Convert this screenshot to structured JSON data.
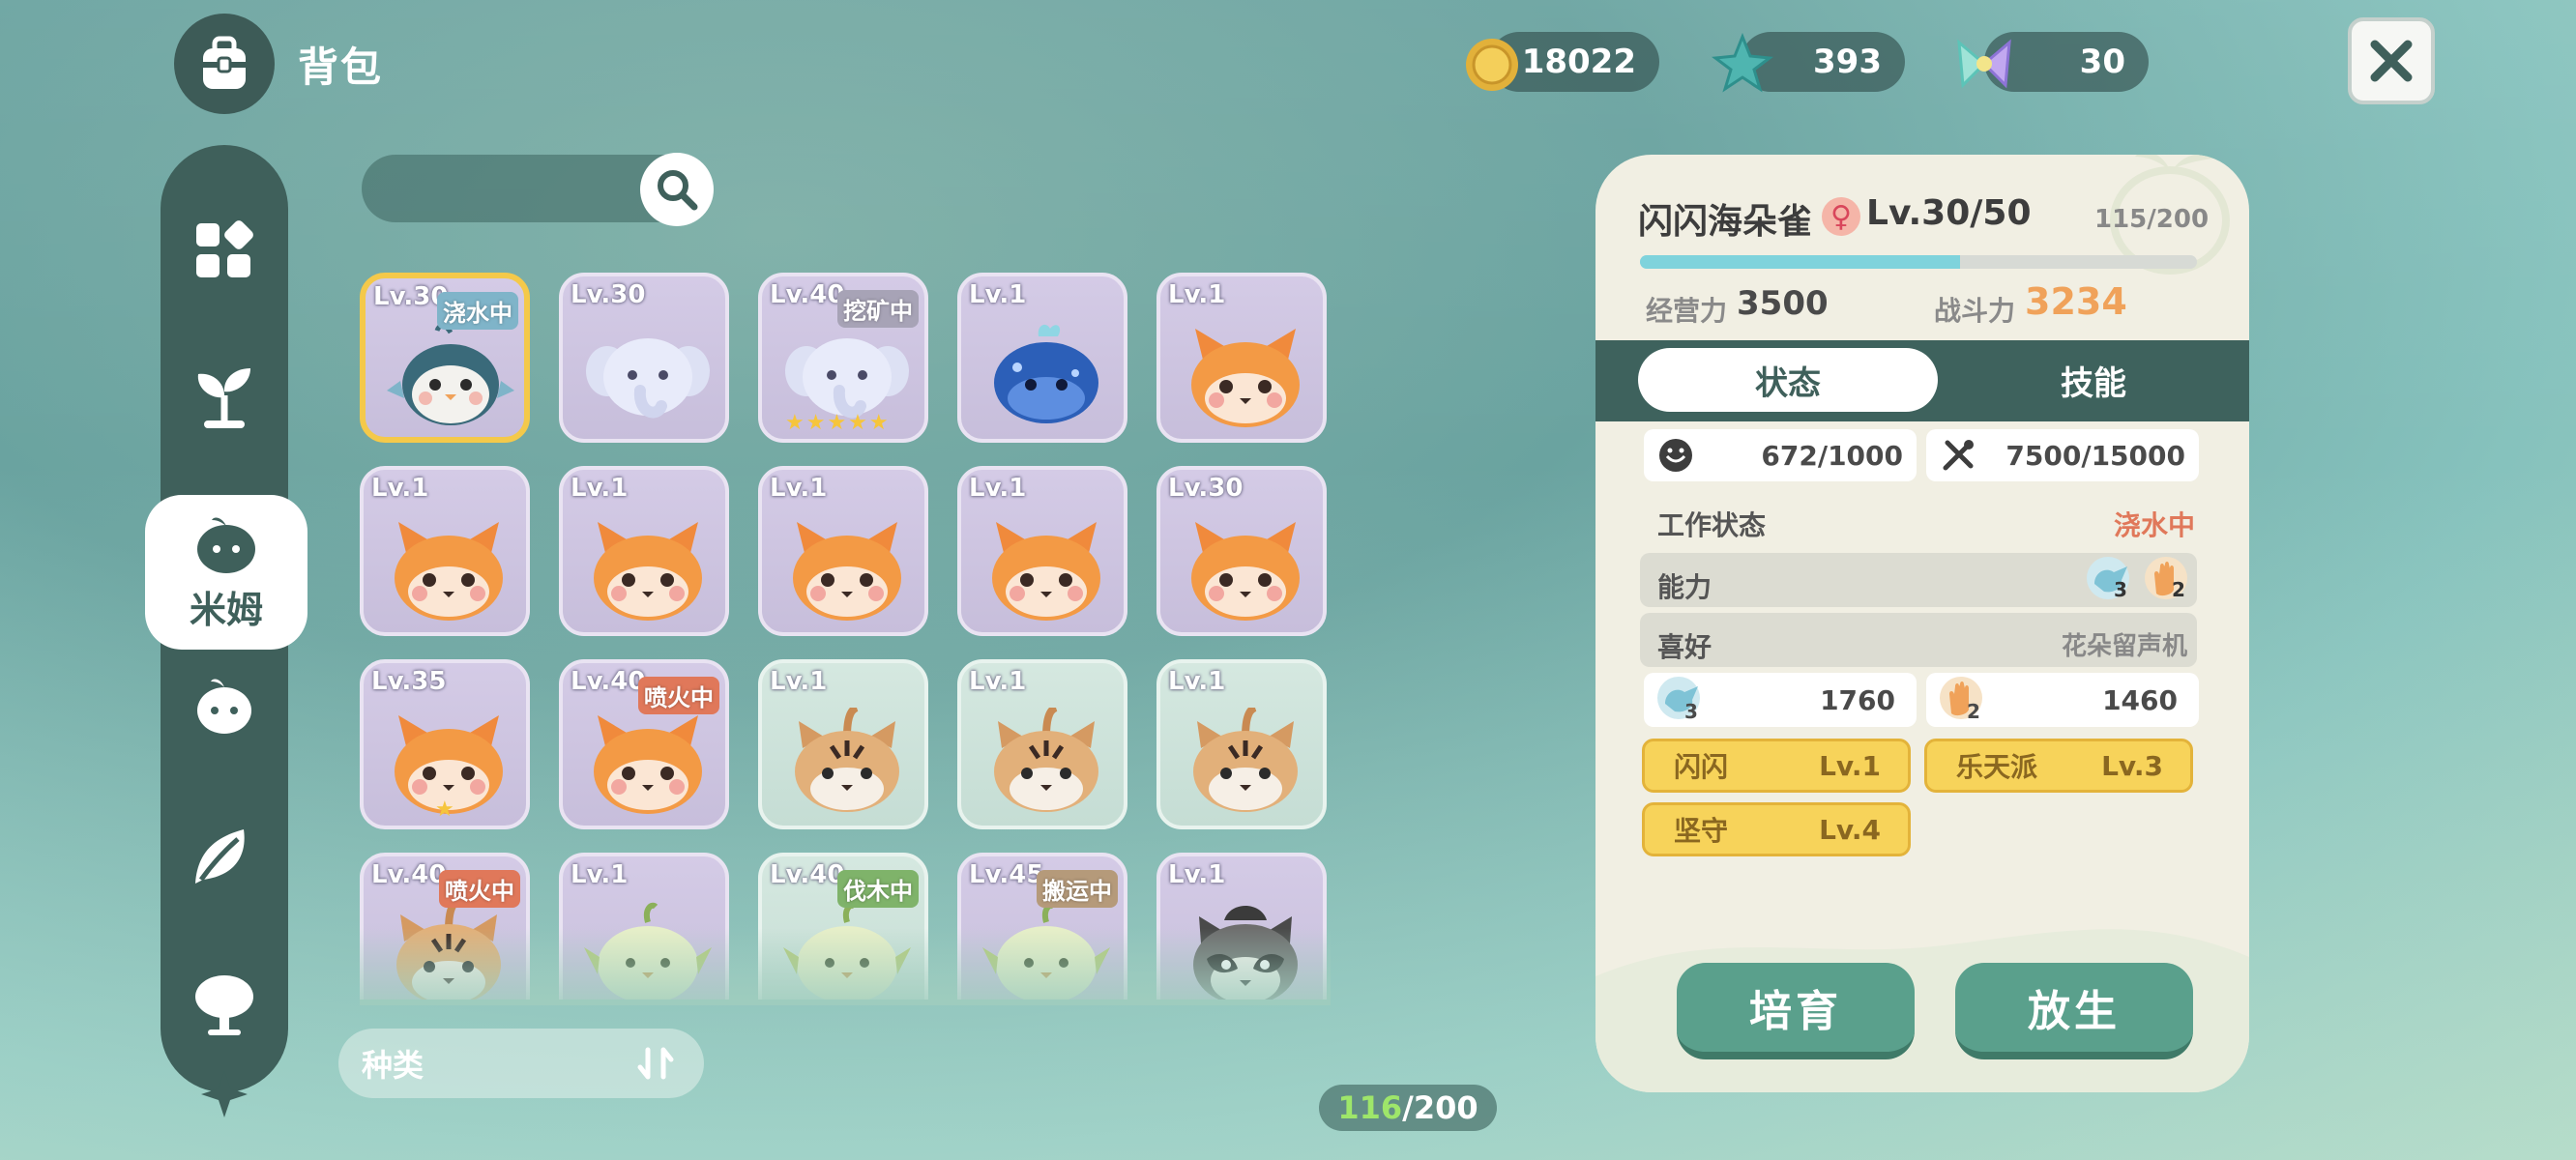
{
  "header": {
    "title": "背包"
  },
  "currencies": [
    {
      "icon": "gold-coin-icon",
      "value": "18022"
    },
    {
      "icon": "blue-star-icon",
      "value": "393"
    },
    {
      "icon": "crystal-bow-icon",
      "value": "30"
    }
  ],
  "sidebar": {
    "active_label": "米姆"
  },
  "grid": {
    "cards": [
      {
        "level": "Lv.30",
        "status": "浇水中",
        "status_color": "#7fb4c9",
        "bg": "purple",
        "creature": "bird",
        "selected": true,
        "stars": ""
      },
      {
        "level": "Lv.30",
        "status": "",
        "status_color": "",
        "bg": "purple",
        "creature": "elephant",
        "selected": false,
        "stars": ""
      },
      {
        "level": "Lv.40",
        "status": "挖矿中",
        "status_color": "#a7a3b6",
        "bg": "purple",
        "creature": "elephant",
        "selected": false,
        "stars": "★★★★★"
      },
      {
        "level": "Lv.1",
        "status": "",
        "status_color": "",
        "bg": "purple",
        "creature": "whale",
        "selected": false,
        "stars": ""
      },
      {
        "level": "Lv.1",
        "status": "",
        "status_color": "",
        "bg": "purple",
        "creature": "fox",
        "selected": false,
        "stars": ""
      },
      {
        "level": "Lv.1",
        "status": "",
        "status_color": "",
        "bg": "purple",
        "creature": "fox",
        "selected": false,
        "stars": ""
      },
      {
        "level": "Lv.1",
        "status": "",
        "status_color": "",
        "bg": "purple",
        "creature": "fox",
        "selected": false,
        "stars": ""
      },
      {
        "level": "Lv.1",
        "status": "",
        "status_color": "",
        "bg": "purple",
        "creature": "fox",
        "selected": false,
        "stars": ""
      },
      {
        "level": "Lv.1",
        "status": "",
        "status_color": "",
        "bg": "purple",
        "creature": "fox",
        "selected": false,
        "stars": ""
      },
      {
        "level": "Lv.30",
        "status": "",
        "status_color": "",
        "bg": "purple",
        "creature": "fox",
        "selected": false,
        "stars": ""
      },
      {
        "level": "Lv.35",
        "status": "",
        "status_color": "",
        "bg": "purple",
        "creature": "fox",
        "selected": false,
        "stars": "★"
      },
      {
        "level": "Lv.40",
        "status": "喷火中",
        "status_color": "#e0785a",
        "bg": "purple",
        "creature": "fox",
        "selected": false,
        "stars": ""
      },
      {
        "level": "Lv.1",
        "status": "",
        "status_color": "",
        "bg": "mint",
        "creature": "tiger",
        "selected": false,
        "stars": ""
      },
      {
        "level": "Lv.1",
        "status": "",
        "status_color": "",
        "bg": "mint",
        "creature": "tiger",
        "selected": false,
        "stars": ""
      },
      {
        "level": "Lv.1",
        "status": "",
        "status_color": "",
        "bg": "mint",
        "creature": "tiger",
        "selected": false,
        "stars": ""
      },
      {
        "level": "Lv.40",
        "status": "喷火中",
        "status_color": "#e0785a",
        "bg": "purple",
        "creature": "tiger",
        "selected": false,
        "stars": ""
      },
      {
        "level": "Lv.1",
        "status": "",
        "status_color": "",
        "bg": "purple",
        "creature": "owl",
        "selected": false,
        "stars": ""
      },
      {
        "level": "Lv.40",
        "status": "伐木中",
        "status_color": "#7fb36a",
        "bg": "mint",
        "creature": "owl",
        "selected": false,
        "stars": ""
      },
      {
        "level": "Lv.45",
        "status": "搬运中",
        "status_color": "#b59a7a",
        "bg": "purple",
        "creature": "owl",
        "selected": false,
        "stars": ""
      },
      {
        "level": "Lv.1",
        "status": "",
        "status_color": "",
        "bg": "purple",
        "creature": "raccoon",
        "selected": false,
        "stars": ""
      }
    ]
  },
  "sort": {
    "label": "种类"
  },
  "capacity": {
    "current": "116",
    "sep_max": "/200"
  },
  "detail": {
    "name": "闪闪海朵雀",
    "gender": "♀",
    "level": "Lv.30/50",
    "exp_text": "115/200",
    "exp_fraction": 0.575,
    "management_label": "经营力",
    "management_value": "3500",
    "combat_label": "战斗力",
    "combat_value": "3234",
    "tabs": {
      "status": "状态",
      "skills": "技能"
    },
    "mood": "672/1000",
    "food": "7500/15000",
    "work_label": "工作状态",
    "work_value": "浇水中",
    "ability_label": "能力",
    "ability_water_level": "3",
    "ability_hand_level": "2",
    "hobby_label": "喜好",
    "hobby_value": "花朵留声机",
    "skill_water_level": "3",
    "skill_water_value": "1760",
    "skill_hand_level": "2",
    "skill_hand_value": "1460",
    "traits": [
      {
        "name": "闪闪",
        "level": "Lv.1"
      },
      {
        "name": "乐天派",
        "level": "Lv.3"
      },
      {
        "name": "坚守",
        "level": "Lv.4"
      }
    ],
    "buttons": {
      "breed": "培育",
      "release": "放生"
    }
  }
}
